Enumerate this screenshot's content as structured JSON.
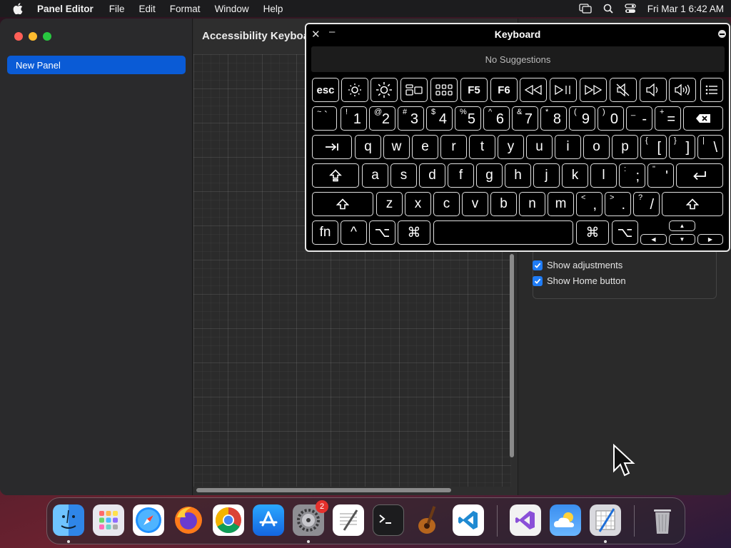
{
  "menubar": {
    "app_name": "Panel Editor",
    "menus": [
      "File",
      "Edit",
      "Format",
      "Window",
      "Help"
    ],
    "clock": "Fri Mar 1  6:42 AM"
  },
  "sidebar": {
    "selected_item": "New Panel"
  },
  "content": {
    "title": "Accessibility Keyboa"
  },
  "inspector": {
    "show_adjustments": "Show adjustments",
    "show_home_button": "Show Home button"
  },
  "keyboard": {
    "title": "Keyboard",
    "suggestions": "No Suggestions",
    "fn_row": [
      "esc",
      "brightness-down-icon",
      "brightness-up-icon",
      "mission-control-icon",
      "launchpad-icon",
      "F5",
      "F6",
      "rewind-icon",
      "play-pause-icon",
      "fast-forward-icon",
      "mute-icon",
      "volume-down-icon",
      "volume-up-icon",
      "list-icon"
    ],
    "number_row": [
      {
        "shift": "~",
        "main": "`"
      },
      {
        "shift": "!",
        "main": "1"
      },
      {
        "shift": "@",
        "main": "2"
      },
      {
        "shift": "#",
        "main": "3"
      },
      {
        "shift": "$",
        "main": "4"
      },
      {
        "shift": "%",
        "main": "5"
      },
      {
        "shift": "^",
        "main": "6"
      },
      {
        "shift": "&",
        "main": "7"
      },
      {
        "shift": "*",
        "main": "8"
      },
      {
        "shift": "(",
        "main": "9"
      },
      {
        "shift": ")",
        "main": "0"
      },
      {
        "shift": "_",
        "main": "-"
      },
      {
        "shift": "+",
        "main": "="
      }
    ],
    "qwerty_row": [
      "q",
      "w",
      "e",
      "r",
      "t",
      "y",
      "u",
      "i",
      "o",
      "p"
    ],
    "qwerty_sym": [
      {
        "shift": "{",
        "main": "["
      },
      {
        "shift": "}",
        "main": "]"
      },
      {
        "shift": "|",
        "main": "\\"
      }
    ],
    "home_row": [
      "a",
      "s",
      "d",
      "f",
      "g",
      "h",
      "j",
      "k",
      "l"
    ],
    "home_sym": [
      {
        "shift": ":",
        "main": ";"
      },
      {
        "shift": "\"",
        "main": "'"
      }
    ],
    "bottom_row": [
      "z",
      "x",
      "c",
      "v",
      "b",
      "n",
      "m"
    ],
    "bottom_sym": [
      {
        "shift": "<",
        "main": ","
      },
      {
        "shift": ">",
        "main": "."
      },
      {
        "shift": "?",
        "main": "/"
      }
    ],
    "fn": "fn",
    "ctrl": "^",
    "option": "⌥",
    "command": "⌘"
  },
  "dock": {
    "apps": [
      "finder-icon",
      "launchpad-icon",
      "safari-icon",
      "firefox-icon",
      "chrome-icon",
      "app-store-icon",
      "system-settings-icon",
      "textedit-icon",
      "terminal-icon",
      "garageband-icon",
      "vscode-icon",
      "visual-studio-icon",
      "weather-icon",
      "instruments-icon",
      "trash-icon"
    ],
    "settings_badge": "2"
  }
}
